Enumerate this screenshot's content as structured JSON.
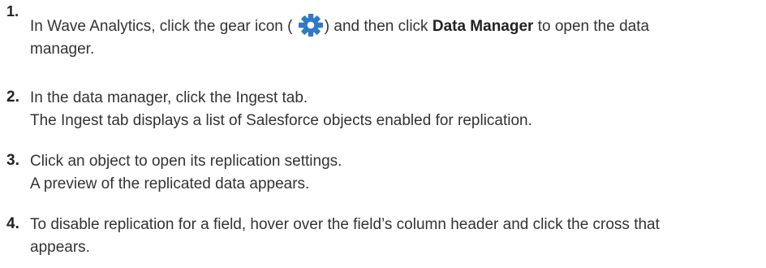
{
  "steps": [
    {
      "number": "1.",
      "text_before": "In Wave Analytics, click the gear icon (",
      "text_after": ") and then click",
      "bold": "Data Manager",
      "text_end": "to open the data",
      "line2": "manager.",
      "icon": "gear-icon",
      "icon_color": "#2f79c7"
    },
    {
      "number": "2.",
      "line1": "In the data manager, click the Ingest tab.",
      "line2": "The Ingest tab displays a list of Salesforce objects enabled for replication."
    },
    {
      "number": "3.",
      "line1": "Click an object to open its replication settings.",
      "line2": "A preview of the replicated data appears."
    },
    {
      "number": "4.",
      "line1": "To disable replication for a field, hover over the field’s column header and click the cross that",
      "line2": "appears."
    }
  ]
}
